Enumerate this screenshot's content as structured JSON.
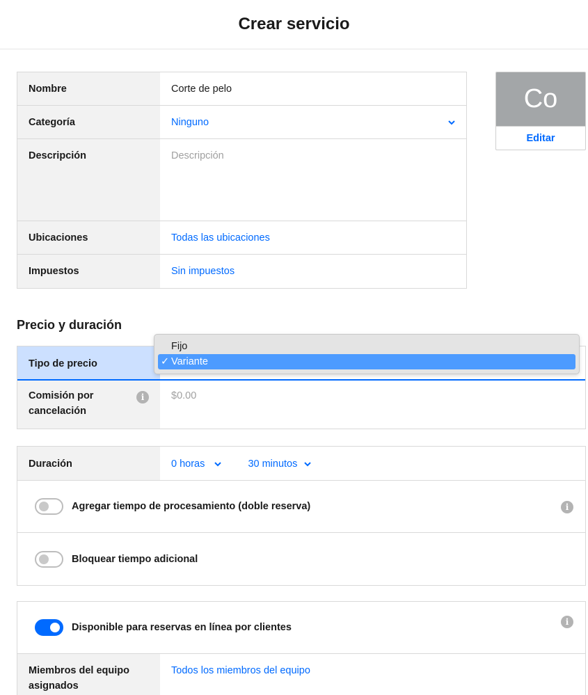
{
  "header": {
    "title": "Crear servicio"
  },
  "basic": {
    "name_label": "Nombre",
    "name_value": "Corte de pelo",
    "category_label": "Categoría",
    "category_value": "Ninguno",
    "description_label": "Descripción",
    "description_placeholder": "Descripción",
    "locations_label": "Ubicaciones",
    "locations_value": "Todas las ubicaciones",
    "taxes_label": "Impuestos",
    "taxes_value": "Sin impuestos"
  },
  "thumbnail": {
    "initials": "Co",
    "edit_label": "Editar",
    "bg_color": "#a3a6a8"
  },
  "price_section": {
    "title": "Precio y duración",
    "price_type_label": "Tipo de precio",
    "price_type_options": [
      "Fijo",
      "Variante"
    ],
    "price_type_selected": "Variante",
    "fee_label": "Comisión por cancelación",
    "fee_placeholder": "$0.00"
  },
  "duration": {
    "label": "Duración",
    "hours_value": "0 horas",
    "minutes_value": "30 minutos",
    "processing_label": "Agregar tiempo de procesamiento (doble reserva)",
    "processing_on": false,
    "block_label": "Bloquear tiempo adicional",
    "block_on": false
  },
  "online": {
    "booking_label": "Disponible para reservas en línea por clientes",
    "booking_on": true,
    "team_label": "Miembros del equipo asignados",
    "team_value": "Todos los miembros del equipo"
  },
  "colors": {
    "accent": "#006aff",
    "label_bg": "#f2f2f2",
    "selected_row_bg": "#cce0ff"
  }
}
